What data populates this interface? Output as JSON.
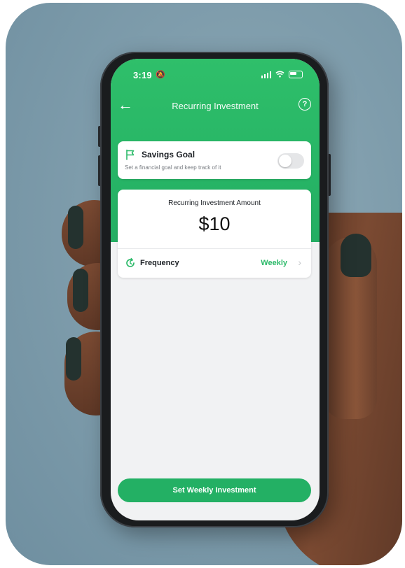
{
  "status_bar": {
    "time": "3:19"
  },
  "nav": {
    "title": "Recurring Investment"
  },
  "savings_goal": {
    "label": "Savings Goal",
    "description": "Set a financial goal and keep track of it",
    "enabled": false
  },
  "investment": {
    "amount_label": "Recurring Investment Amount",
    "amount_value": "$10",
    "frequency_label": "Frequency",
    "frequency_value": "Weekly"
  },
  "cta": {
    "label": "Set Weekly Investment"
  },
  "colors": {
    "accent": "#2dba6a",
    "header_gradient_start": "#2fbf6a",
    "button": "#23b064",
    "background": "#7f9dac"
  },
  "icons": {
    "back": "arrow-left-icon",
    "help": "help-circle-icon",
    "flag": "flag-icon",
    "frequency": "refresh-icon",
    "chevron": "chevron-right-icon",
    "signal": "signal-icon",
    "wifi": "wifi-icon",
    "battery": "battery-icon"
  }
}
